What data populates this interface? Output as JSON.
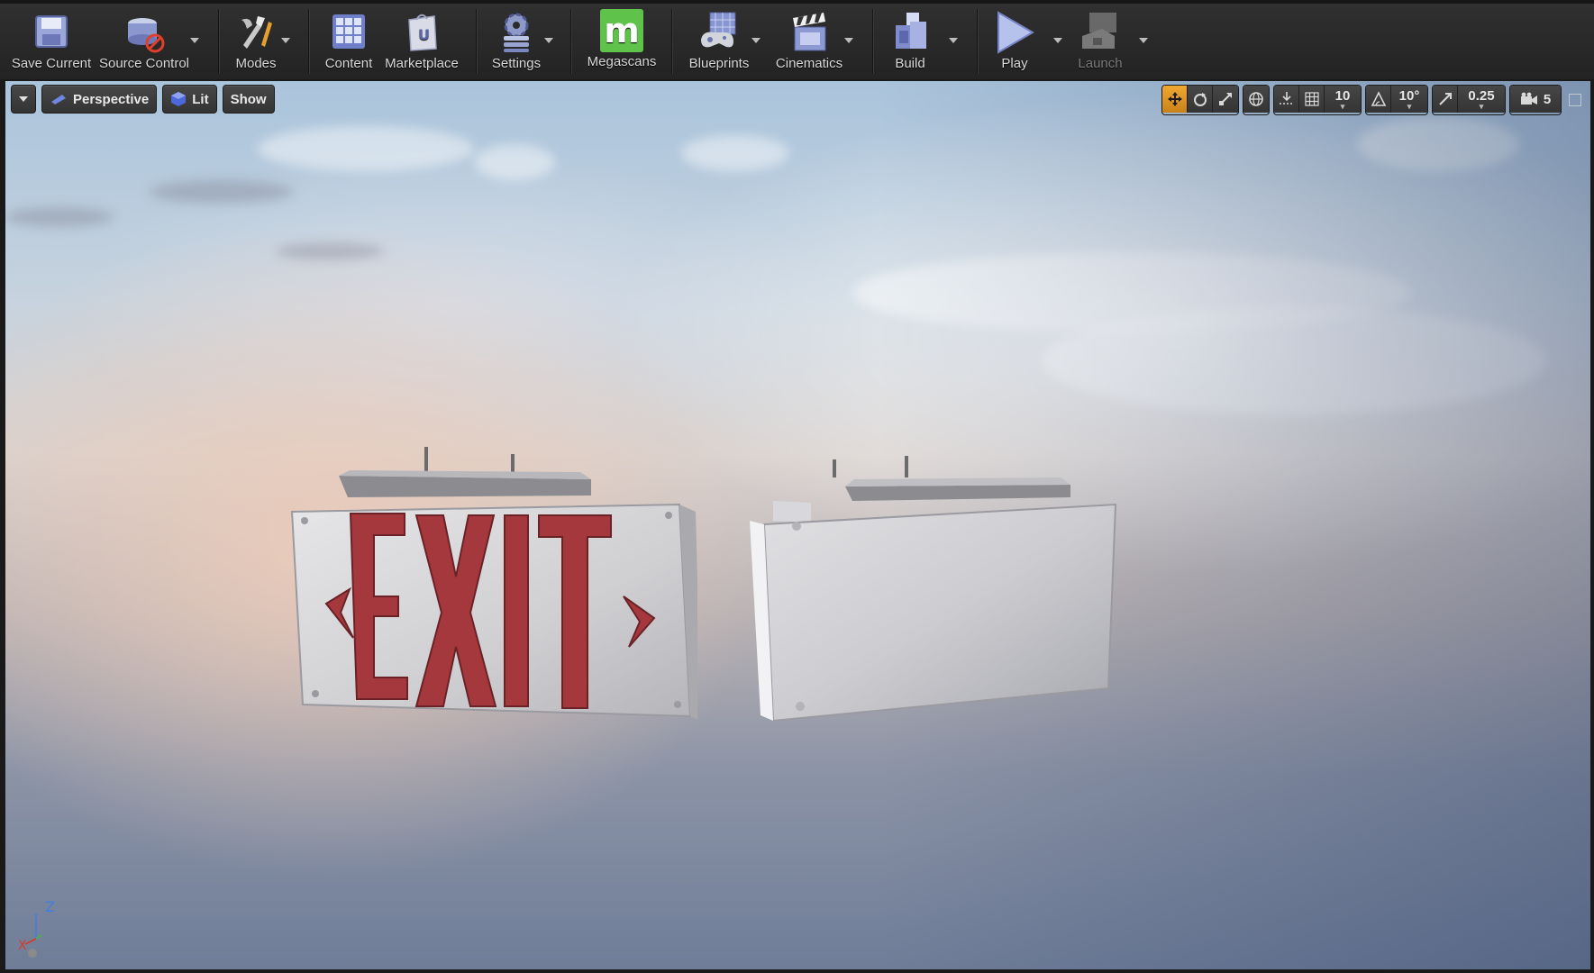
{
  "toolbar": {
    "items": [
      {
        "label": "Save Current",
        "icon": "save-icon"
      },
      {
        "label": "Source Control",
        "icon": "source-control-icon"
      },
      {
        "label": "Modes",
        "icon": "modes-icon"
      },
      {
        "label": "Content",
        "icon": "content-icon"
      },
      {
        "label": "Marketplace",
        "icon": "marketplace-icon"
      },
      {
        "label": "Settings",
        "icon": "settings-icon"
      },
      {
        "label": "Megascans",
        "icon": "megascans-icon"
      },
      {
        "label": "Blueprints",
        "icon": "blueprints-icon"
      },
      {
        "label": "Cinematics",
        "icon": "cinematics-icon"
      },
      {
        "label": "Build",
        "icon": "build-icon"
      },
      {
        "label": "Play",
        "icon": "play-icon"
      },
      {
        "label": "Launch",
        "icon": "launch-icon",
        "disabled": true
      }
    ],
    "megascans_logo_letter": "m"
  },
  "viewport": {
    "view_mode": "Perspective",
    "lighting": "Lit",
    "show": "Show",
    "grid_snap": "10",
    "rotation_snap": "10°",
    "scale_snap": "0.25",
    "camera_speed": "5",
    "axis_label_z": "Z",
    "axis_label_x": "X",
    "scene": {
      "objects": [
        "exit sign (front)",
        "exit sign (back)"
      ],
      "exit_sign_text": "EXIT",
      "arrow_left": "‹",
      "arrow_right": "›"
    }
  },
  "colors": {
    "accent": "#f0a830",
    "exit_text": "#a5383d",
    "sign_body": "#dcdcde"
  }
}
